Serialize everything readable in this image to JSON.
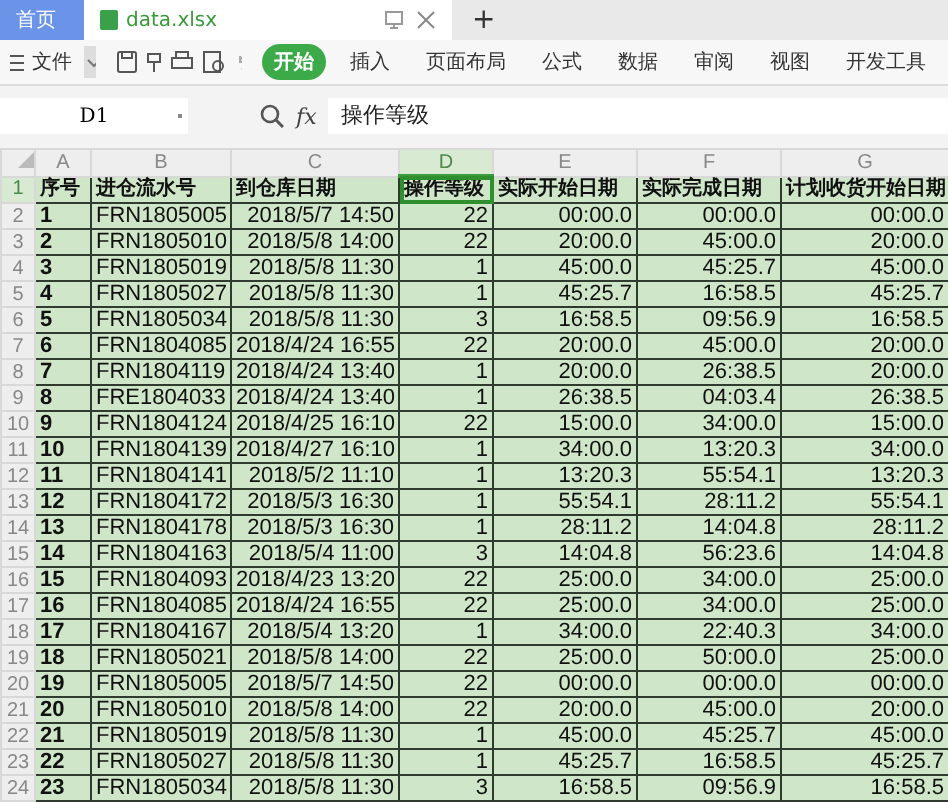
{
  "tabs": [
    {
      "label": "首页",
      "kind": "home",
      "selected": false
    },
    {
      "label": "data.xlsx",
      "kind": "file",
      "selected": true
    }
  ],
  "new_tab": "+",
  "toolbar": {
    "menu": "文件",
    "ribbon_tabs": [
      {
        "label": "开始",
        "selected": true
      },
      {
        "label": "插入",
        "selected": false
      },
      {
        "label": "页面布局",
        "selected": false
      },
      {
        "label": "公式",
        "selected": false
      },
      {
        "label": "数据",
        "selected": false
      },
      {
        "label": "审阅",
        "selected": false
      },
      {
        "label": "视图",
        "selected": false
      },
      {
        "label": "开发工具",
        "selected": false
      }
    ]
  },
  "formula_bar": {
    "name_box": "D1",
    "fx": "fx",
    "value": "操作等级"
  },
  "columns": [
    {
      "label": "A",
      "selected": false
    },
    {
      "label": "B",
      "selected": false
    },
    {
      "label": "C",
      "selected": false
    },
    {
      "label": "D",
      "selected": true
    },
    {
      "label": "E",
      "selected": false
    },
    {
      "label": "F",
      "selected": false
    },
    {
      "label": "G",
      "selected": false
    }
  ],
  "rows": [
    {
      "number": "1",
      "selected": true,
      "cells": [
        "序号",
        "进仓流水号",
        "到仓库日期",
        "操作等级",
        "实际开始日期",
        "实际完成日期",
        "计划收货开始日期"
      ]
    },
    {
      "number": "2",
      "selected": false,
      "cells": [
        "1",
        "FRN1805005",
        "2018/5/7 14:50",
        "22",
        "00:00.0",
        "00:00.0",
        "00:00.0"
      ]
    },
    {
      "number": "3",
      "selected": false,
      "cells": [
        "2",
        "FRN1805010",
        "2018/5/8 14:00",
        "22",
        "20:00.0",
        "45:00.0",
        "20:00.0"
      ]
    },
    {
      "number": "4",
      "selected": false,
      "cells": [
        "3",
        "FRN1805019",
        "2018/5/8 11:30",
        "1",
        "45:00.0",
        "45:25.7",
        "45:00.0"
      ]
    },
    {
      "number": "5",
      "selected": false,
      "cells": [
        "4",
        "FRN1805027",
        "2018/5/8 11:30",
        "1",
        "45:25.7",
        "16:58.5",
        "45:25.7"
      ]
    },
    {
      "number": "6",
      "selected": false,
      "cells": [
        "5",
        "FRN1805034",
        "2018/5/8 11:30",
        "3",
        "16:58.5",
        "09:56.9",
        "16:58.5"
      ]
    },
    {
      "number": "7",
      "selected": false,
      "cells": [
        "6",
        "FRN1804085",
        "2018/4/24 16:55",
        "22",
        "20:00.0",
        "45:00.0",
        "20:00.0"
      ]
    },
    {
      "number": "8",
      "selected": false,
      "cells": [
        "7",
        "FRN1804119",
        "2018/4/24 13:40",
        "1",
        "20:00.0",
        "26:38.5",
        "20:00.0"
      ]
    },
    {
      "number": "9",
      "selected": false,
      "cells": [
        "8",
        "FRE1804033",
        "2018/4/24 13:40",
        "1",
        "26:38.5",
        "04:03.4",
        "26:38.5"
      ]
    },
    {
      "number": "10",
      "selected": false,
      "cells": [
        "9",
        "FRN1804124",
        "2018/4/25 16:10",
        "22",
        "15:00.0",
        "34:00.0",
        "15:00.0"
      ]
    },
    {
      "number": "11",
      "selected": false,
      "cells": [
        "10",
        "FRN1804139",
        "2018/4/27 16:10",
        "1",
        "34:00.0",
        "13:20.3",
        "34:00.0"
      ]
    },
    {
      "number": "12",
      "selected": false,
      "cells": [
        "11",
        "FRN1804141",
        "2018/5/2 11:10",
        "1",
        "13:20.3",
        "55:54.1",
        "13:20.3"
      ]
    },
    {
      "number": "13",
      "selected": false,
      "cells": [
        "12",
        "FRN1804172",
        "2018/5/3 16:30",
        "1",
        "55:54.1",
        "28:11.2",
        "55:54.1"
      ]
    },
    {
      "number": "14",
      "selected": false,
      "cells": [
        "13",
        "FRN1804178",
        "2018/5/3 16:30",
        "1",
        "28:11.2",
        "14:04.8",
        "28:11.2"
      ]
    },
    {
      "number": "15",
      "selected": false,
      "cells": [
        "14",
        "FRN1804163",
        "2018/5/4 11:00",
        "3",
        "14:04.8",
        "56:23.6",
        "14:04.8"
      ]
    },
    {
      "number": "16",
      "selected": false,
      "cells": [
        "15",
        "FRN1804093",
        "2018/4/23 13:20",
        "22",
        "25:00.0",
        "34:00.0",
        "25:00.0"
      ]
    },
    {
      "number": "17",
      "selected": false,
      "cells": [
        "16",
        "FRN1804085",
        "2018/4/24 16:55",
        "22",
        "25:00.0",
        "34:00.0",
        "25:00.0"
      ]
    },
    {
      "number": "18",
      "selected": false,
      "cells": [
        "17",
        "FRN1804167",
        "2018/5/4 13:20",
        "1",
        "34:00.0",
        "22:40.3",
        "34:00.0"
      ]
    },
    {
      "number": "19",
      "selected": false,
      "cells": [
        "18",
        "FRN1805021",
        "2018/5/8 14:00",
        "22",
        "25:00.0",
        "50:00.0",
        "25:00.0"
      ]
    },
    {
      "number": "20",
      "selected": false,
      "cells": [
        "19",
        "FRN1805005",
        "2018/5/7 14:50",
        "22",
        "00:00.0",
        "00:00.0",
        "00:00.0"
      ]
    },
    {
      "number": "21",
      "selected": false,
      "cells": [
        "20",
        "FRN1805010",
        "2018/5/8 14:00",
        "22",
        "20:00.0",
        "45:00.0",
        "20:00.0"
      ]
    },
    {
      "number": "22",
      "selected": false,
      "cells": [
        "21",
        "FRN1805019",
        "2018/5/8 11:30",
        "1",
        "45:00.0",
        "45:25.7",
        "45:00.0"
      ]
    },
    {
      "number": "23",
      "selected": false,
      "cells": [
        "22",
        "FRN1805027",
        "2018/5/8 11:30",
        "1",
        "45:25.7",
        "16:58.5",
        "45:25.7"
      ]
    },
    {
      "number": "24",
      "selected": false,
      "cells": [
        "23",
        "FRN1805034",
        "2018/5/8 11:30",
        "3",
        "16:58.5",
        "09:56.9",
        "16:58.5"
      ]
    }
  ]
}
